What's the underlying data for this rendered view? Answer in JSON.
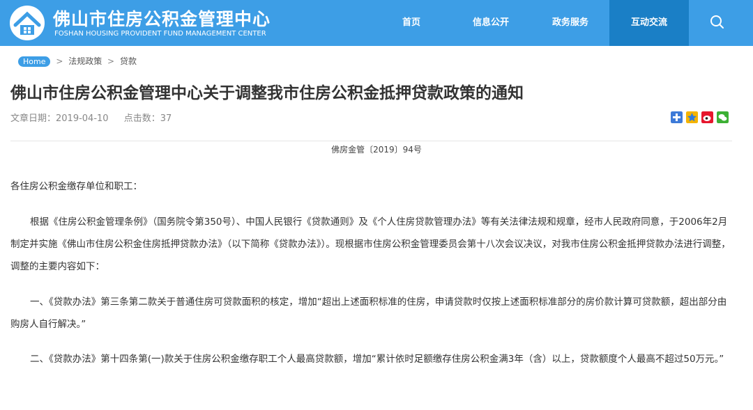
{
  "site": {
    "title": "佛山市住房公积金管理中心",
    "subtitle": "FOSHAN HOUSING PROVIDENT FUND MANAGEMENT CENTER"
  },
  "nav": {
    "items": [
      "首页",
      "信息公开",
      "政务服务",
      "互动交流"
    ],
    "active": "互动交流"
  },
  "breadcrumb": {
    "home": "Home",
    "level1": "法规政策",
    "level2": "贷款",
    "separator": ">"
  },
  "article": {
    "title": "佛山市住房公积金管理中心关于调整我市住房公积金抵押贷款政策的通知",
    "date": "文章日期：2019-04-10",
    "clicks": "点击数：37",
    "doc_number": "佛房金管〔2019〕94号",
    "salutation": "各住房公积金缴存单位和职工：",
    "paragraphs": [
      "根据《住房公积金管理条例》（国务院令第350号）、中国人民银行《贷款通则》及《个人住房贷款管理办法》等有关法律法规和规章，经市人民政府同意，于2006年2月制定并实施《佛山市住房公积金住房抵押贷款办法》（以下简称《贷款办法》）。现根据市住房公积金管理委员会第十八次会议决议，对我市住房公积金抵押贷款办法进行调整，调整的主要内容如下：",
      "一、《贷款办法》第三条第二款关于普通住房可贷款面积的核定，增加“超出上述面积标准的住房，申请贷款时仅按上述面积标准部分的房价款计算可贷款额，超出部分由购房人自行解决。”",
      "二、《贷款办法》第十四条第(一)款关于住房公积金缴存职工个人最高贷款额，增加“累计依时足额缴存住房公积金满3年（含）以上，贷款额度个人最高不超过50万元。”"
    ]
  },
  "share_icons": [
    "plus-share-icon",
    "qzone-share-icon",
    "weibo-share-icon",
    "wechat-share-icon"
  ],
  "colors": {
    "header": "#3d9ee6",
    "nav_active": "#1a7fc6"
  }
}
